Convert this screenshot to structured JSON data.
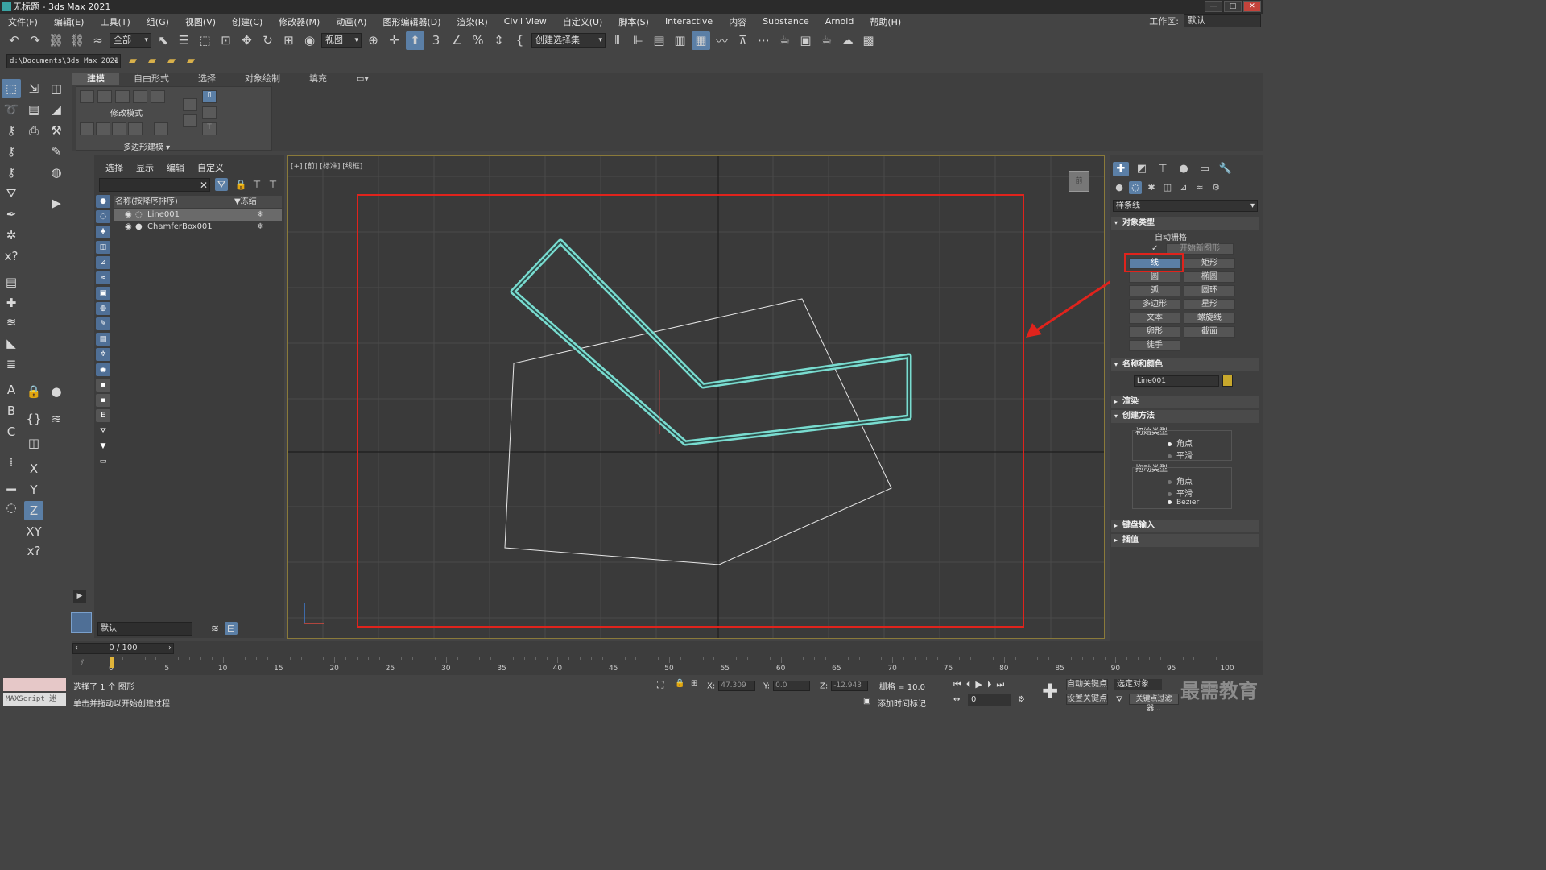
{
  "window": {
    "title": "无标题 - 3ds Max 2021"
  },
  "menu": [
    "文件(F)",
    "编辑(E)",
    "工具(T)",
    "组(G)",
    "视图(V)",
    "创建(C)",
    "修改器(M)",
    "动画(A)",
    "图形编辑器(D)",
    "渲染(R)",
    "Civil View",
    "自定义(U)",
    "脚本(S)",
    "Interactive",
    "内容",
    "Substance",
    "Arnold",
    "帮助(H)"
  ],
  "workspace": {
    "label": "工作区:",
    "value": "默认"
  },
  "toolbar": {
    "filter_select": "全部",
    "view_select": "视图",
    "selection_set": "创建选择集"
  },
  "pathbar": {
    "project_path": "d:\\Documents\\3ds Max 2021"
  },
  "ribbon": {
    "tabs": [
      "建模",
      "自由形式",
      "选择",
      "对象绘制",
      "填充"
    ],
    "panel_label": "修改模式",
    "footer_label": "多边形建模"
  },
  "scene_explorer": {
    "tabs": [
      "选择",
      "显示",
      "编辑",
      "自定义"
    ],
    "column_name": "名称(按降序排序)",
    "column_freeze": "▼冻结",
    "rows": [
      {
        "name": "Line001",
        "selected": true
      },
      {
        "name": "ChamferBox001",
        "selected": false
      }
    ],
    "layer_value": "默认"
  },
  "viewport": {
    "label": "[+] [前] [标准] [线框]"
  },
  "command_panel": {
    "category_select": "样条线",
    "object_type_title": "对象类型",
    "auto_grid": "自动栅格",
    "start_new_shape": "开始新图形",
    "buttons": [
      "线",
      "矩形",
      "圆",
      "椭圆",
      "弧",
      "圆环",
      "多边形",
      "星形",
      "文本",
      "螺旋线",
      "卵形",
      "截面",
      "徒手"
    ],
    "name_color_title": "名称和颜色",
    "object_name": "Line001",
    "object_color": "#c8a82c",
    "render_title": "渲染",
    "creation_method_title": "创建方法",
    "initial_type_title": "初始类型",
    "initial_options": [
      "角点",
      "平滑"
    ],
    "drag_type_title": "拖动类型",
    "drag_options": [
      "角点",
      "平滑",
      "Bezier"
    ],
    "keyboard_entry_title": "键盘输入",
    "interpolation_title": "插值"
  },
  "timeline": {
    "frame_display": "0 / 100",
    "ticks": [
      "0",
      "5",
      "10",
      "15",
      "20",
      "25",
      "30",
      "35",
      "40",
      "45",
      "50",
      "55",
      "60",
      "65",
      "70",
      "75",
      "80",
      "85",
      "90",
      "95",
      "100"
    ]
  },
  "status": {
    "maxscript_label": "MAXScript 迷",
    "selection_info": "选择了 1 个 图形",
    "prompt": "单击并拖动以开始创建过程",
    "x_value": "47.309",
    "y_value": "0.0",
    "z_value": "-12.943",
    "grid": "栅格 = 10.0",
    "add_time_tag": "添加时间标记",
    "auto_key": "自动关键点",
    "set_key": "设置关键点",
    "selected_object": "选定对象",
    "key_filters": "关键点过滤器...",
    "frame_field": "0",
    "watermark": "最需教育"
  },
  "colors": {
    "highlight_box": "#e0231c",
    "annotation_arrow": "#e0231c",
    "selected_shape": "#79dcd0",
    "wire_shape": "#e6e6e6",
    "active_button": "#5b7fa6"
  }
}
